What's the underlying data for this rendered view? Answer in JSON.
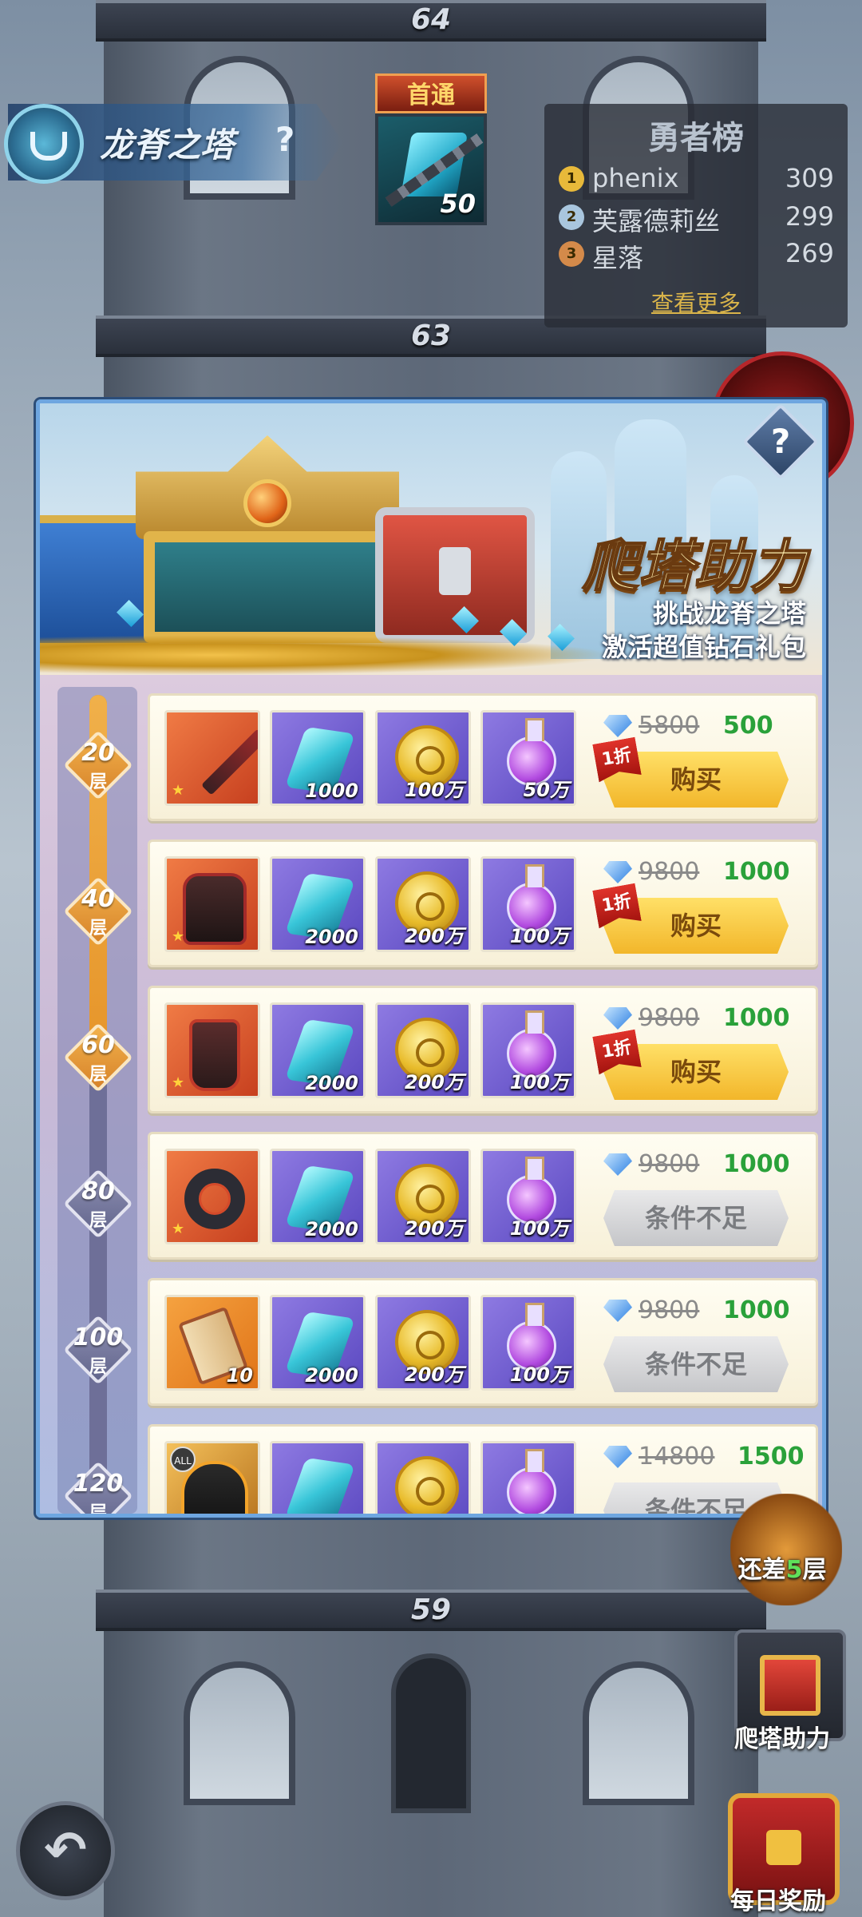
{
  "hud": {
    "title": "龙脊之塔",
    "help": "?",
    "first_clear_label": "首通",
    "first_clear_qty": "50"
  },
  "floors": {
    "top": "64",
    "second": "63",
    "lower": "59"
  },
  "ranking": {
    "title": "勇者榜",
    "entries": [
      {
        "rank": "1",
        "name": "phenix",
        "score": "309"
      },
      {
        "rank": "2",
        "name": "芙露德莉丝",
        "score": "299"
      },
      {
        "rank": "3",
        "name": "星落",
        "score": "269"
      }
    ],
    "see_more": "查看更多"
  },
  "popup": {
    "title": "爬塔助力",
    "subtitle_1": "挑战龙脊之塔",
    "subtitle_2": "激活超值钻石礼包",
    "help": "?",
    "milestones": [
      {
        "num": "20",
        "unit": "层",
        "reached": true
      },
      {
        "num": "40",
        "unit": "层",
        "reached": true
      },
      {
        "num": "60",
        "unit": "层",
        "reached": true
      },
      {
        "num": "80",
        "unit": "层",
        "reached": false
      },
      {
        "num": "100",
        "unit": "层",
        "reached": false
      },
      {
        "num": "120",
        "unit": "层",
        "reached": false
      }
    ],
    "rows": [
      {
        "items": [
          "",
          "1000",
          "100万",
          "50万"
        ],
        "old_price": "5800",
        "new_price": "500",
        "discount": "1折",
        "button": "购买"
      },
      {
        "items": [
          "",
          "2000",
          "200万",
          "100万"
        ],
        "old_price": "9800",
        "new_price": "1000",
        "discount": "1折",
        "button": "购买"
      },
      {
        "items": [
          "",
          "2000",
          "200万",
          "100万"
        ],
        "old_price": "9800",
        "new_price": "1000",
        "discount": "1折",
        "button": "购买"
      },
      {
        "items": [
          "",
          "2000",
          "200万",
          "100万"
        ],
        "old_price": "9800",
        "new_price": "1000",
        "discount": "",
        "button": "条件不足"
      },
      {
        "items": [
          "10",
          "2000",
          "200万",
          "100万"
        ],
        "old_price": "9800",
        "new_price": "1000",
        "discount": "",
        "button": "条件不足"
      },
      {
        "items": [
          "",
          "",
          "",
          ""
        ],
        "old_price": "14800",
        "new_price": "1500",
        "discount": "",
        "button": "条件不足"
      }
    ],
    "all_badge": "ALL"
  },
  "side": {
    "remaining_prefix": "还差",
    "remaining_count": "5",
    "remaining_suffix": "层",
    "climb_help": "爬塔助力",
    "daily_reward": "每日奖励",
    "back_icon": "↶"
  },
  "colors": {
    "price_green": "#2aa13a",
    "buy_yellow": "#f2b62a",
    "disabled_gray": "#c5c6c9",
    "milestone_reached": "#e6952a"
  }
}
